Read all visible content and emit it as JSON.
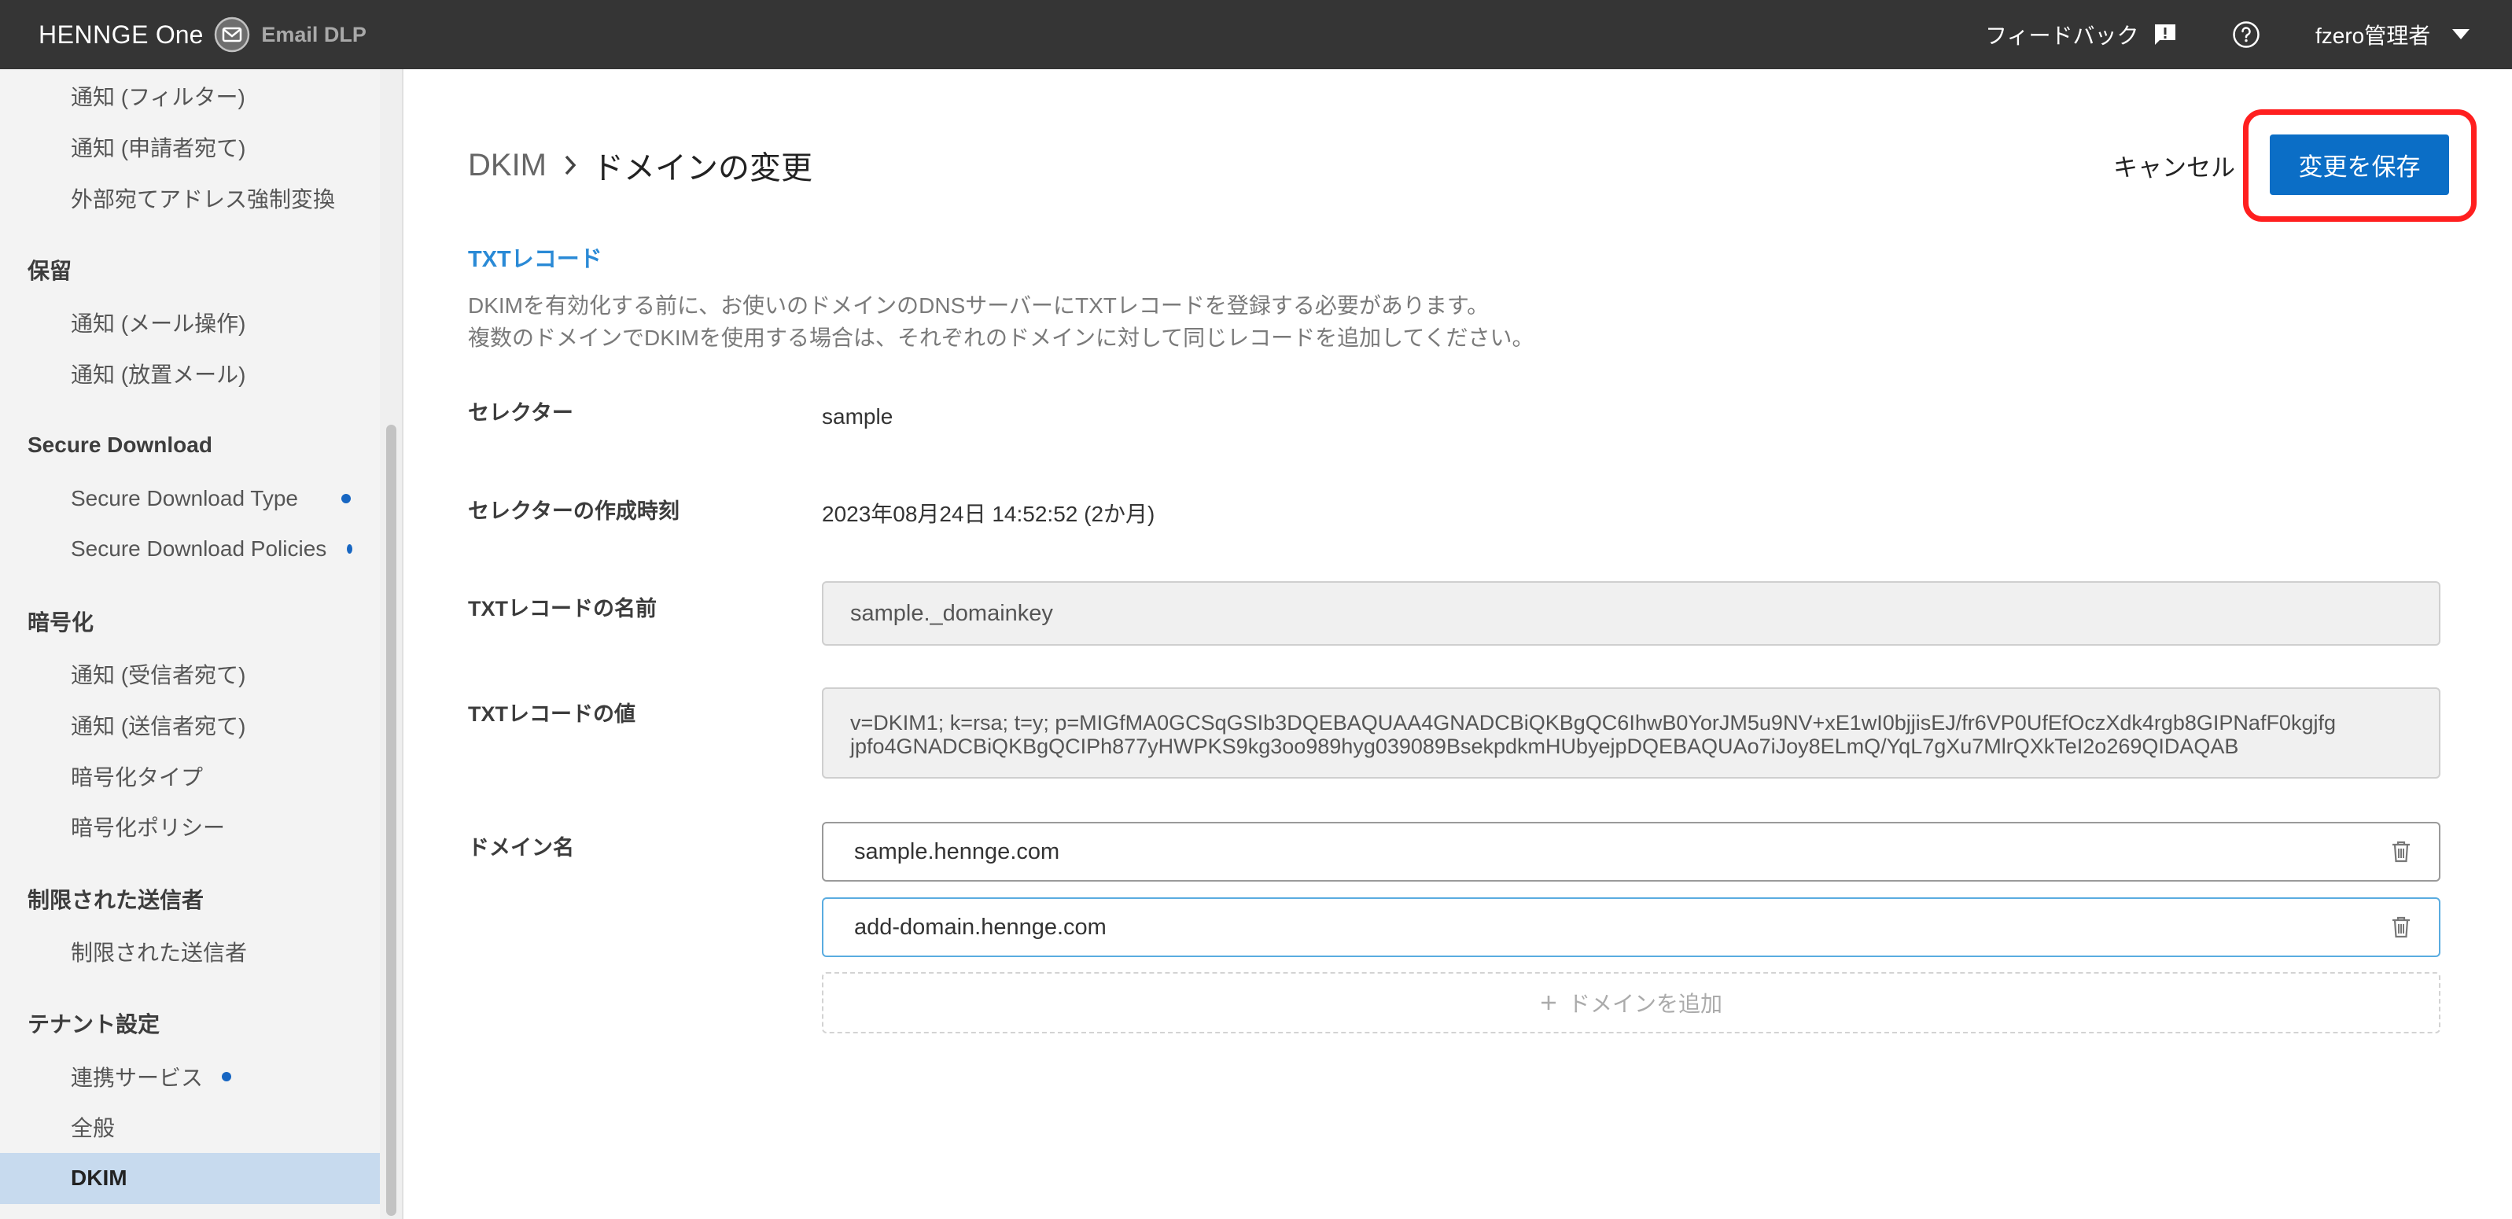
{
  "header": {
    "brand": {
      "name": "HENNGE",
      "suffix": "One"
    },
    "product": "Email DLP",
    "feedback_label": "フィードバック",
    "user_label": "fzero管理者",
    "icons": [
      "envelope-icon",
      "feedback-icon",
      "help-icon",
      "caret-down-icon"
    ]
  },
  "sidebar": {
    "groups": [
      {
        "items": [
          {
            "label": "通知 (フィルター)"
          },
          {
            "label": "通知 (申請者宛て)"
          },
          {
            "label": "外部宛てアドレス強制変換"
          }
        ]
      },
      {
        "title": "保留",
        "items": [
          {
            "label": "通知 (メール操作)"
          },
          {
            "label": "通知 (放置メール)"
          }
        ]
      },
      {
        "title": "Secure Download",
        "items": [
          {
            "label": "Secure Download Type",
            "indicator_dot": true
          },
          {
            "label": "Secure Download Policies",
            "indicator_dot": true
          }
        ]
      },
      {
        "title": "暗号化",
        "items": [
          {
            "label": "通知 (受信者宛て)"
          },
          {
            "label": "通知 (送信者宛て)"
          },
          {
            "label": "暗号化タイプ"
          },
          {
            "label": "暗号化ポリシー"
          }
        ]
      },
      {
        "title": "制限された送信者",
        "items": [
          {
            "label": "制限された送信者"
          }
        ]
      },
      {
        "title": "テナント設定",
        "items": [
          {
            "label": "連携サービス",
            "indicator_dot": true
          },
          {
            "label": "全般"
          },
          {
            "label": "DKIM",
            "selected": true
          }
        ]
      }
    ]
  },
  "main": {
    "breadcrumb": {
      "parent": "DKIM",
      "current": "ドメインの変更"
    },
    "actions": {
      "cancel_label": "キャンセル",
      "save_label": "変更を保存"
    },
    "txt_record": {
      "title": "TXTレコード",
      "description": [
        "DKIMを有効化する前に、お使いのドメインのDNSサーバーにTXTレコードを登録する必要があります。",
        "複数のドメインでDKIMを使用する場合は、それぞれのドメインに対して同じレコードを追加してください。"
      ]
    },
    "form": {
      "selector": {
        "label": "セレクター",
        "value": "sample"
      },
      "created_at": {
        "label": "セレクターの作成時刻",
        "value": "2023年08月24日 14:52:52 (2か月)"
      },
      "txt_name": {
        "label": "TXTレコードの名前",
        "value": "sample._domainkey"
      },
      "txt_value": {
        "label": "TXTレコードの値",
        "value_lines": [
          "v=DKIM1; k=rsa; t=y; p=MIGfMA0GCSqGSIb3DQEBAQUAA4GNADCBiQKBgQC6IhwB0YorJM5u9NV+xE1wI0bjjisEJ/fr6VP0UfEfOczXdk4rgb8GIPNafF0kgjfg",
          "jpfo4GNADCBiQKBgQCIPh877yHWPKS9kg3oo989hyg039089BsekpdkmHUbyejpDQEBAQUAo7iJoy8ELmQ/YqL7gXu7MlrQXkTeI2o269QIDAQAB"
        ]
      },
      "domains": {
        "label": "ドメイン名",
        "entries": [
          "sample.hennge.com",
          "add-domain.hennge.com"
        ],
        "add_label": "ドメインを追加",
        "icons": [
          "trash-icon",
          "plus-icon"
        ]
      }
    }
  },
  "colors": {
    "topbar": "#353535",
    "primary_button": "#0b6ec6",
    "section_title": "#2a8ad6",
    "sidebar_selected": "#c7daee",
    "indicator_dot": "#1766c2",
    "focused_input_border": "#5aace0",
    "annotation_outline": "#ff1f1f"
  }
}
